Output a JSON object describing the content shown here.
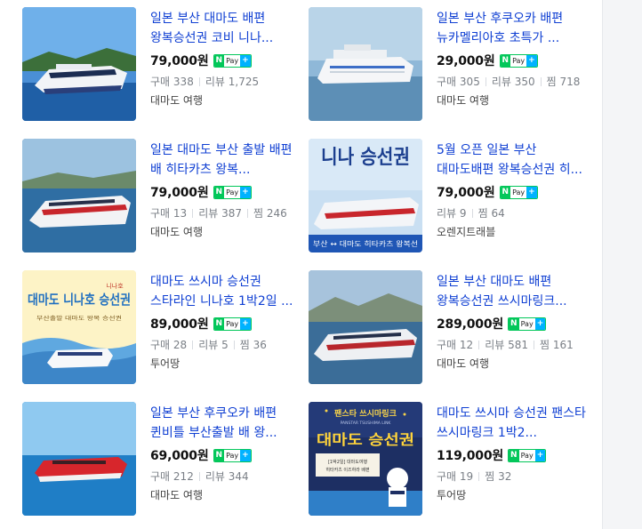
{
  "npay": {
    "n": "N",
    "pay": "Pay",
    "plus": "+"
  },
  "colors": {
    "title": "#0f3fd3",
    "price": "#111111",
    "npay_green": "#03c75a",
    "npay_plus": "#00b2ff"
  },
  "products": [
    {
      "title": "일본 부산 대마도 배편 왕복승선권 코비 니나...",
      "price": "79,000원",
      "stats": [
        {
          "label": "구매",
          "value": "338"
        },
        {
          "label": "리뷰",
          "value": "1,725"
        }
      ],
      "seller": "대마도 여행"
    },
    {
      "title": "일본 부산 후쿠오카 배편 뉴카멜리아호 초특가 ...",
      "price": "29,000원",
      "stats": [
        {
          "label": "구매",
          "value": "305"
        },
        {
          "label": "리뷰",
          "value": "350"
        },
        {
          "label": "찜",
          "value": "718"
        }
      ],
      "seller": "대마도 여행"
    },
    {
      "title": "일본 대마도 부산 출발 배편 배 히타카츠 왕복...",
      "price": "79,000원",
      "stats": [
        {
          "label": "구매",
          "value": "13"
        },
        {
          "label": "리뷰",
          "value": "387"
        },
        {
          "label": "찜",
          "value": "246"
        }
      ],
      "seller": "대마도 여행"
    },
    {
      "title": "5월 오픈 일본 부산 대마도배편 왕복승선권 히...",
      "price": "79,000원",
      "stats": [
        {
          "label": "리뷰",
          "value": "9"
        },
        {
          "label": "찜",
          "value": "64"
        }
      ],
      "seller": "오렌지트래블"
    },
    {
      "title": "대마도 쓰시마 승선권 스타라인 니나호 1박2일 ...",
      "price": "89,000원",
      "stats": [
        {
          "label": "구매",
          "value": "28"
        },
        {
          "label": "리뷰",
          "value": "5"
        },
        {
          "label": "찜",
          "value": "36"
        }
      ],
      "seller": "투어땅"
    },
    {
      "title": "일본 부산 대마도 배편 왕복승선권 쓰시마링크...",
      "price": "289,000원",
      "stats": [
        {
          "label": "구매",
          "value": "12"
        },
        {
          "label": "리뷰",
          "value": "581"
        },
        {
          "label": "찜",
          "value": "161"
        }
      ],
      "seller": "대마도 여행"
    },
    {
      "title": "일본 부산 후쿠오카 배편 퀸비틀 부산출발 배 왕...",
      "price": "69,000원",
      "stats": [
        {
          "label": "구매",
          "value": "212"
        },
        {
          "label": "리뷰",
          "value": "344"
        }
      ],
      "seller": "대마도 여행"
    },
    {
      "title": "대마도 쓰시마 승선권 팬스타 쓰시마링크 1박2...",
      "price": "119,000원",
      "stats": [
        {
          "label": "구매",
          "value": "19"
        },
        {
          "label": "찜",
          "value": "32"
        }
      ],
      "seller": "투어땅"
    }
  ],
  "thumb_text": {
    "t4_big": "니나 승선권",
    "t4_strip": "부산 ↔ 대마도 히타카츠 왕복선",
    "t5_main": "대마도 니나호 승선권",
    "t5_small": "니나호",
    "t5_sub": "부산출발 대마도 왕복 승선권",
    "t8_top": "팬스타 쓰시마링크",
    "t8_tag": "PANSTAR TSUSHIMA LINK",
    "t8_main": "대마도 승선권",
    "t8_sub1": "[1박2일] 대마도여행",
    "t8_sub2": "히타카츠 이즈하라 배편"
  }
}
